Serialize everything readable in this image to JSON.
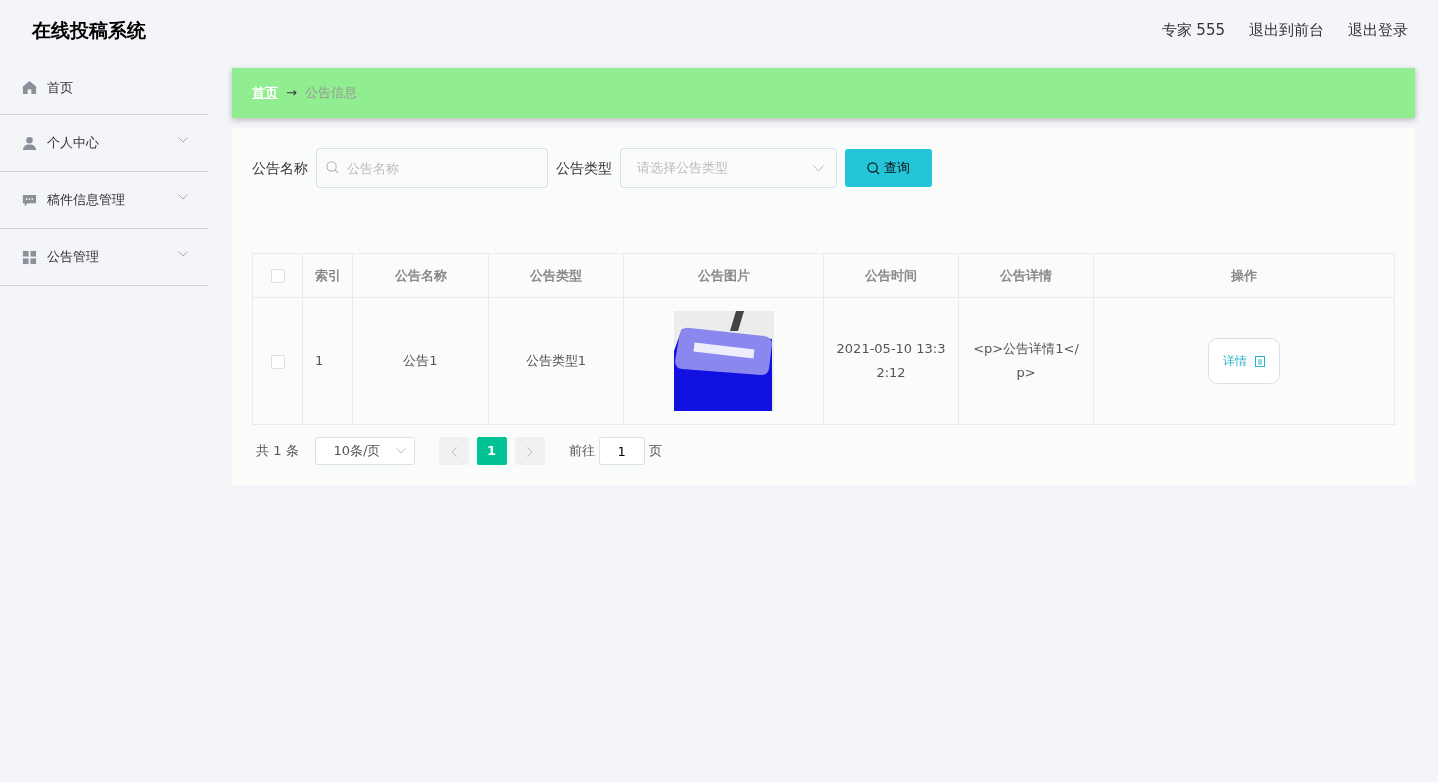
{
  "header": {
    "title": "在线投稿系统",
    "links": [
      "专家 555",
      "退出到前台",
      "退出登录"
    ]
  },
  "sidebar": {
    "items": [
      {
        "label": "首页",
        "kind": "home",
        "expandable": false
      },
      {
        "label": "个人中心",
        "kind": "user",
        "expandable": true
      },
      {
        "label": "稿件信息管理",
        "kind": "chat",
        "expandable": true
      },
      {
        "label": "公告管理",
        "kind": "grid",
        "expandable": true
      }
    ]
  },
  "breadcrumb": {
    "home": "首页",
    "separator": "→",
    "current": "公告信息"
  },
  "search": {
    "name_label": "公告名称",
    "name_placeholder": "公告名称",
    "type_label": "公告类型",
    "type_placeholder": "请选择公告类型",
    "button": "查询"
  },
  "table": {
    "columns": [
      "索引",
      "公告名称",
      "公告类型",
      "公告图片",
      "公告时间",
      "公告详情",
      "操作"
    ],
    "rows": [
      {
        "checked": false,
        "index": "1",
        "name": "公告1",
        "type": "公告类型1",
        "time": "2021-05-10 13:32:12",
        "detail": "<p>公告详情1</p>",
        "action": "详情"
      }
    ],
    "header_checked": false
  },
  "pagination": {
    "total": "共 1 条",
    "page_size": "10条/页",
    "pages": [
      {
        "label": "1",
        "selected": true
      }
    ],
    "goto_label": "前往",
    "goto_value": "1",
    "goto_suffix": "页"
  }
}
